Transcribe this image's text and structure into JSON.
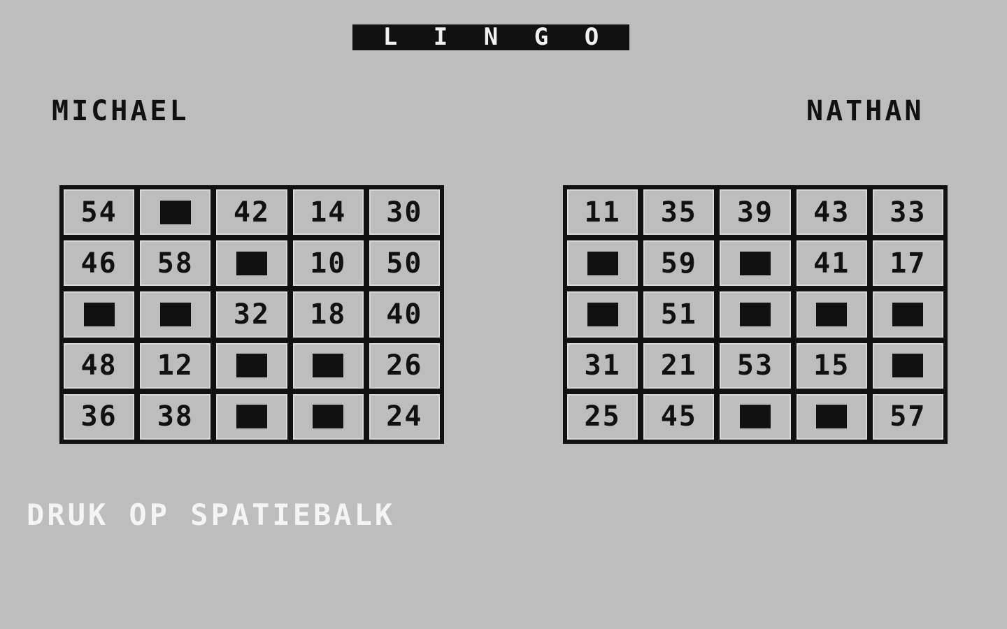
{
  "title": {
    "letters": [
      "L",
      "I",
      "N",
      "G",
      "O"
    ]
  },
  "players": [
    {
      "name": "MICHAEL",
      "board": [
        [
          "54",
          null,
          "42",
          "14",
          "30"
        ],
        [
          "46",
          "58",
          null,
          "10",
          "50"
        ],
        [
          null,
          null,
          "32",
          "18",
          "40"
        ],
        [
          "48",
          "12",
          null,
          null,
          "26"
        ],
        [
          "36",
          "38",
          null,
          null,
          "24"
        ]
      ]
    },
    {
      "name": "NATHAN",
      "board": [
        [
          "11",
          "35",
          "39",
          "43",
          "33"
        ],
        [
          null,
          "59",
          null,
          "41",
          "17"
        ],
        [
          null,
          "51",
          null,
          null,
          null
        ],
        [
          "31",
          "21",
          "53",
          "15",
          null
        ],
        [
          "25",
          "45",
          null,
          null,
          "57"
        ]
      ]
    }
  ],
  "prompt": "DRUK OP SPATIEBALK",
  "legend": {
    "null_cell": "marked-square-icon"
  }
}
